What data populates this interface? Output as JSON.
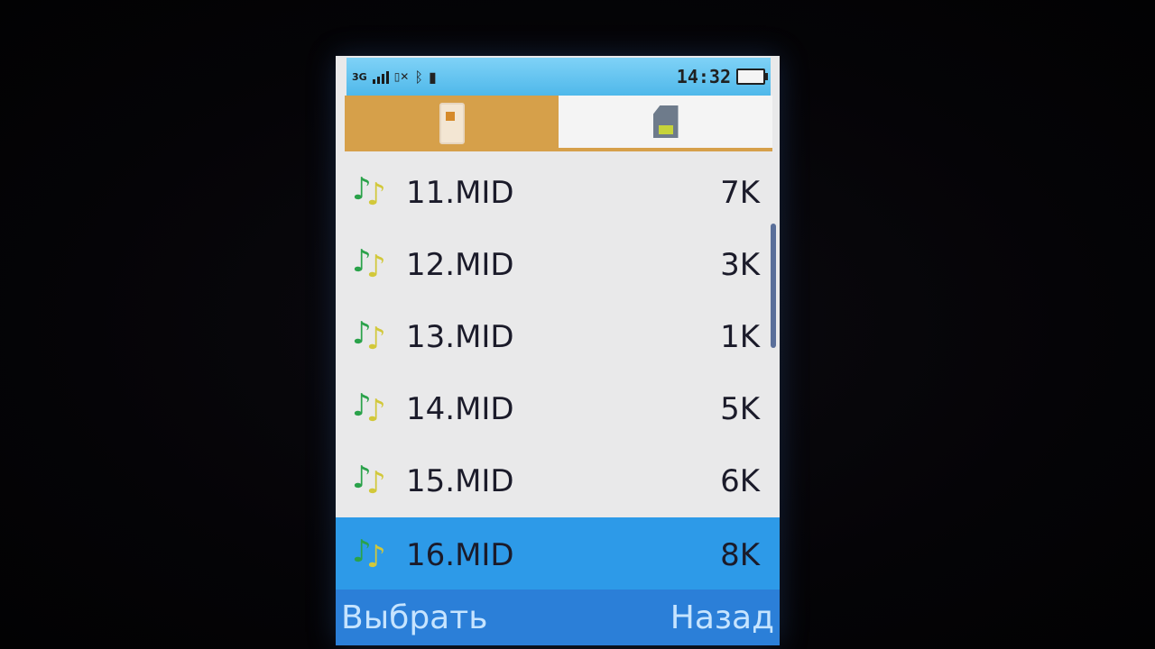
{
  "status_bar": {
    "network": "3G",
    "icons": [
      "signal-icon",
      "no-sim-icon",
      "bluetooth-icon",
      "memory-card-icon",
      "battery-icon"
    ],
    "time": "14:32"
  },
  "tabs": [
    {
      "icon": "phone-icon",
      "active": true
    },
    {
      "icon": "sd-card-icon",
      "active": false
    }
  ],
  "files": [
    {
      "name": "11.MID",
      "size": "7K"
    },
    {
      "name": "12.MID",
      "size": "3K"
    },
    {
      "name": "13.MID",
      "size": "1K"
    },
    {
      "name": "14.MID",
      "size": "5K"
    },
    {
      "name": "15.MID",
      "size": "6K"
    },
    {
      "name": "16.MID",
      "size": "8K"
    }
  ],
  "selected_index": 5,
  "softkeys": {
    "left": "Выбрать",
    "right": "Назад"
  },
  "colors": {
    "status_bar": "#4fb8ea",
    "tab_active": "#d6a04a",
    "selection": "#2d9ae8",
    "softkey_bar": "#2b7fd8"
  }
}
